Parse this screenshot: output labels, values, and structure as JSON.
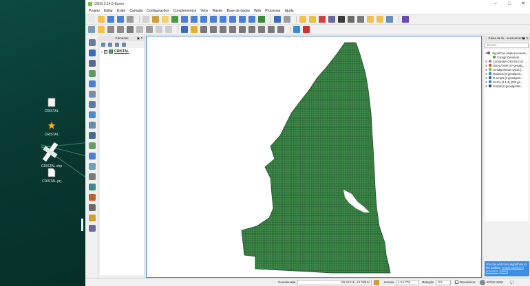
{
  "desktop": {
    "icons": [
      {
        "label": "CRISTAL",
        "icon": "folder-doc-icon"
      },
      {
        "label": "CRISTAL",
        "icon": "gdal-star-icon"
      },
      {
        "label": "CRISTAL.shp",
        "icon": "satellite-icon"
      },
      {
        "label": "CRISTAL.prj",
        "icon": "document-icon"
      }
    ]
  },
  "window": {
    "title": "QGIS 2.14.9-Essen",
    "menu": [
      "Projeto",
      "Editar",
      "Exibir",
      "Camada",
      "Configurações",
      "Complementos",
      "Vetor",
      "Raster",
      "Base de dados",
      "Web",
      "Processar",
      "Ajuda"
    ]
  },
  "layers_panel": {
    "title": "Camadas",
    "layers": [
      {
        "name": "CRISTAL",
        "checked": true,
        "color": "#48a868"
      }
    ]
  },
  "toolbox": {
    "title": "Caixa de fe...ocessamento",
    "search_placeholder": "Buscar...",
    "items": [
      {
        "label": "Algoritmos usados recente...",
        "icon": "clock-icon",
        "color": "#6a6a6a"
      },
      {
        "label": "Corrigir Geometri...",
        "icon": "geometry-icon",
        "color": "#5a9a3a"
      },
      {
        "label": "Comandos GRASS GIS ...",
        "icon": "grass-icon",
        "color": "#8a8a8a"
      },
      {
        "label": "GDAL/OGR [47 geoalg...",
        "icon": "gdal-icon",
        "color": "#d85a2a"
      },
      {
        "label": "Geoalgoritmos QGIS [...",
        "icon": "qgis-icon",
        "color": "#7cbf3e"
      },
      {
        "label": "Modelos [0 geoalgorit...",
        "icon": "model-icon",
        "color": "#4a7fd4"
      },
      {
        "label": "R scripts [0 geoalgorit...",
        "icon": "r-icon",
        "color": "#2a6ab8"
      },
      {
        "label": "SAGA (2.1.2) [235 ge...",
        "icon": "saga-icon",
        "color": "#3a7ab0"
      },
      {
        "label": "Scripts [0 geoalgoritm...",
        "icon": "script-icon",
        "color": "#444444"
      }
    ],
    "tip_text": "You can add more algorithms to the toolbox,",
    "tip_link": "enable additional providers.",
    "tip_close": "[close]"
  },
  "statusbar": {
    "coord_label": "Coordenada",
    "coord_value": "-55.21415,-12.08844",
    "scale_label": "Escala",
    "scale_value": "1:14.776",
    "rotation_label": "Rotação",
    "rotation_value": "0.0",
    "render_label": "Renderizar",
    "crs_value": "EPSG:4326"
  },
  "map": {
    "fill_color": "#3e8a4a",
    "grid_color": "#1e4a26"
  }
}
